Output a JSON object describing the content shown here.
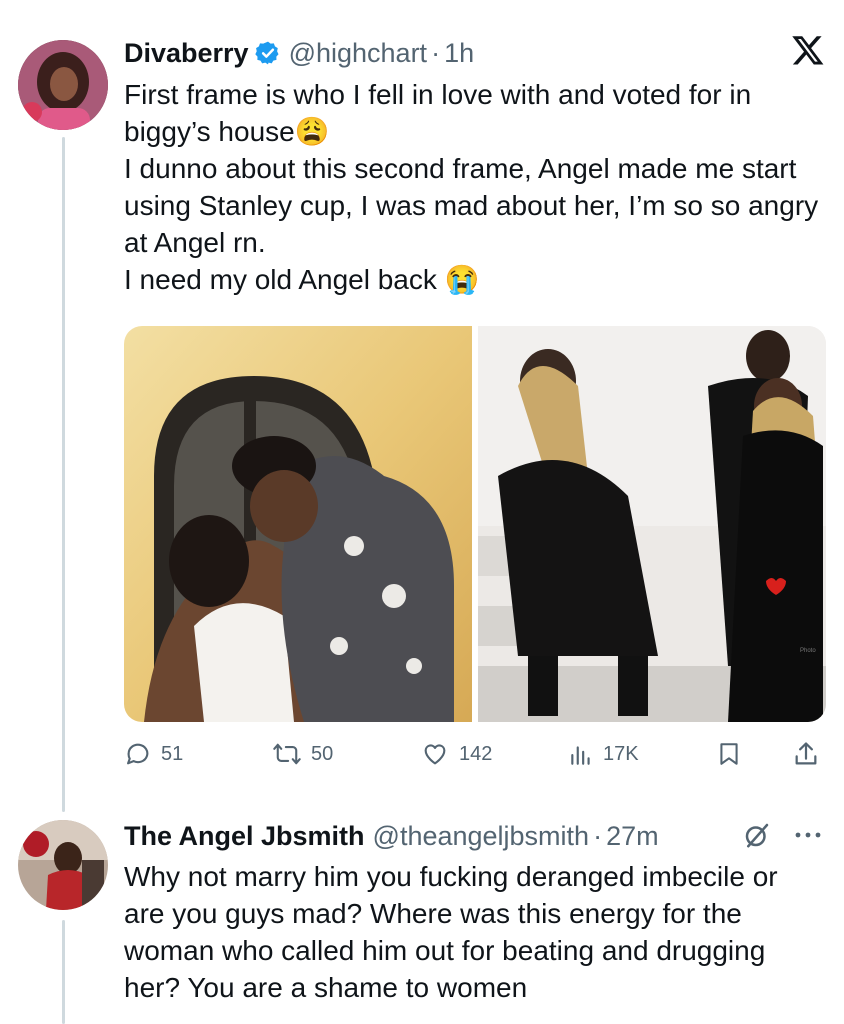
{
  "tweet": {
    "author_name": "Divaberry",
    "handle": "@highchart",
    "separator": "·",
    "time": "1h",
    "text": "First frame is who I fell in love with and voted for in biggy’s house😩\nI dunno about this second frame, Angel made me start using Stanley cup, I was mad about her, I’m so so angry at Angel rn.\nI need my old Angel back 😭",
    "verified": true,
    "platform_icon": "x-logo-icon",
    "media_watermark": "Photo",
    "stats": {
      "replies": "51",
      "reposts": "50",
      "likes": "142",
      "views": "17K"
    }
  },
  "reply": {
    "author_name": "The Angel Jbsmith",
    "handle": "@theangeljbsmith",
    "separator": "·",
    "time": "27m",
    "text": "Why not marry him you fucking deranged imbecile or are you guys mad? Where was this energy for the woman who called him out for beating and drugging her? You are a shame to women"
  },
  "colors": {
    "verified_blue": "#1d9bf0",
    "secondary_text": "#536471",
    "thread_line": "#cfd9de"
  }
}
